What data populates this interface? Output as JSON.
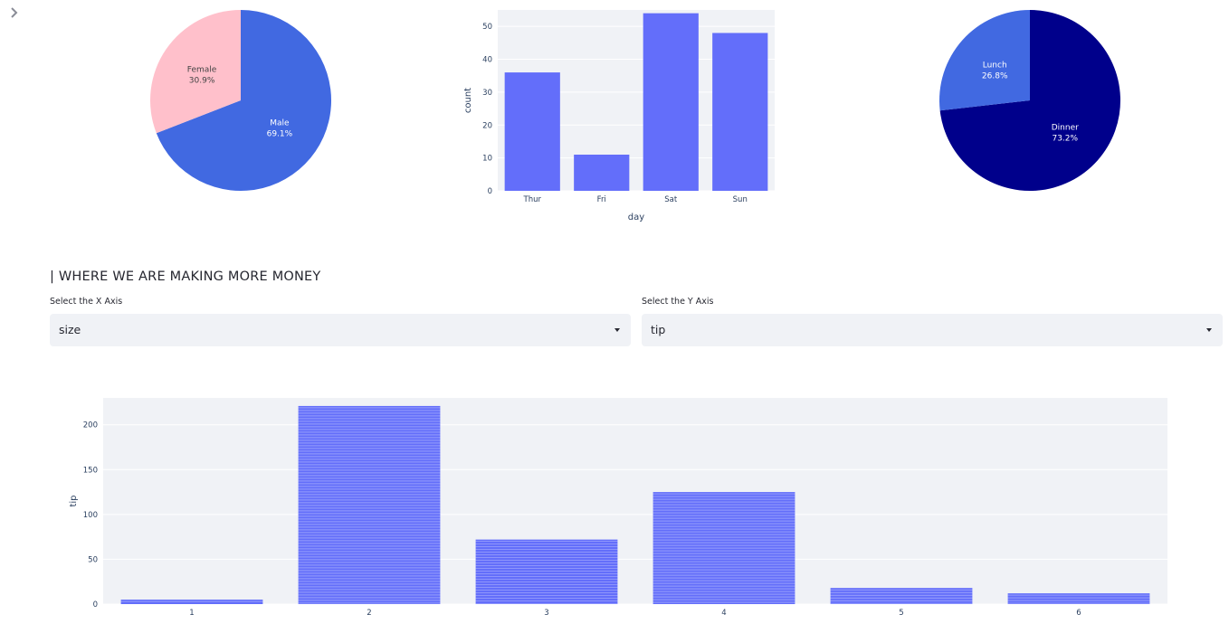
{
  "section_title": "| WHERE WE ARE MAKING MORE MONEY",
  "x_select": {
    "label": "Select the X Axis",
    "value": "size"
  },
  "y_select": {
    "label": "Select the Y Axis",
    "value": "tip"
  },
  "icons": {
    "sidebar_toggle": "chevron-right-icon",
    "dropdown": "caret-down-icon"
  },
  "colors": {
    "bar": "#636efa",
    "plot_bg": "#e5ecf6",
    "pie_male": "#4169e1",
    "pie_female": "#ffc0cb",
    "pie_dinner": "#00008b",
    "pie_lunch": "#4169e1"
  },
  "chart_data": [
    {
      "type": "pie",
      "labels": [
        "Male",
        "Female"
      ],
      "values": [
        69.1,
        30.9
      ],
      "texts": [
        "69.1%",
        "30.9%"
      ]
    },
    {
      "type": "bar",
      "categories": [
        "Thur",
        "Fri",
        "Sat",
        "Sun"
      ],
      "values": [
        36,
        11,
        54,
        48
      ],
      "xlabel": "day",
      "ylabel": "count",
      "ylim": [
        0,
        55
      ],
      "yticks": [
        0,
        10,
        20,
        30,
        40,
        50
      ]
    },
    {
      "type": "pie",
      "labels": [
        "Dinner",
        "Lunch"
      ],
      "values": [
        73.2,
        26.8
      ],
      "texts": [
        "73.2%",
        "26.8%"
      ]
    },
    {
      "type": "bar",
      "categories": [
        "1",
        "2",
        "3",
        "4",
        "5",
        "6"
      ],
      "values": [
        5,
        221,
        72,
        125,
        18,
        12
      ],
      "xlabel": "",
      "ylabel": "tip",
      "ylim": [
        0,
        230
      ],
      "yticks": [
        0,
        50,
        100,
        150,
        200
      ]
    }
  ]
}
